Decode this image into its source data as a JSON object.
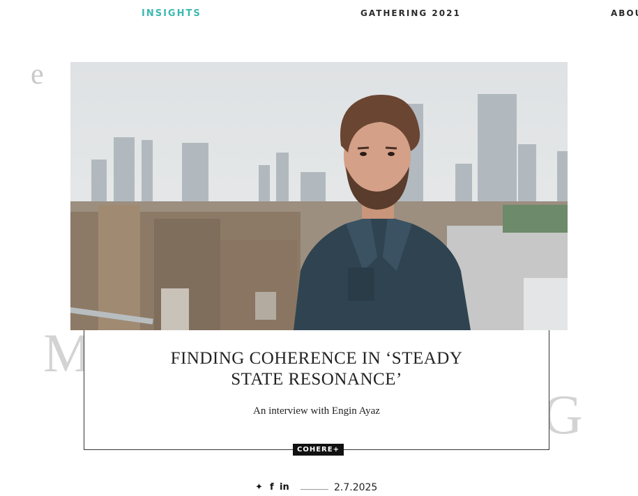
{
  "nav": {
    "items": [
      {
        "label": "INSIGHTS",
        "active": true
      },
      {
        "label": "GATHERING 2021",
        "active": false
      },
      {
        "label": "ABOU",
        "active": false
      }
    ],
    "active_color": "#3bb8b0"
  },
  "background_letters": [
    "e",
    "M",
    "G"
  ],
  "article": {
    "title": "FINDING COHERENCE IN ‘STEADY STATE RESONANCE’",
    "subtitle": "An interview with Engin Ayaz",
    "badge": "COHERE+",
    "date": "2.7.2025"
  },
  "share": {
    "icons": [
      "twitter-icon",
      "facebook-icon",
      "linkedin-icon"
    ],
    "glyphs": {
      "twitter": "✦",
      "facebook": "f",
      "linkedin": "in"
    }
  }
}
